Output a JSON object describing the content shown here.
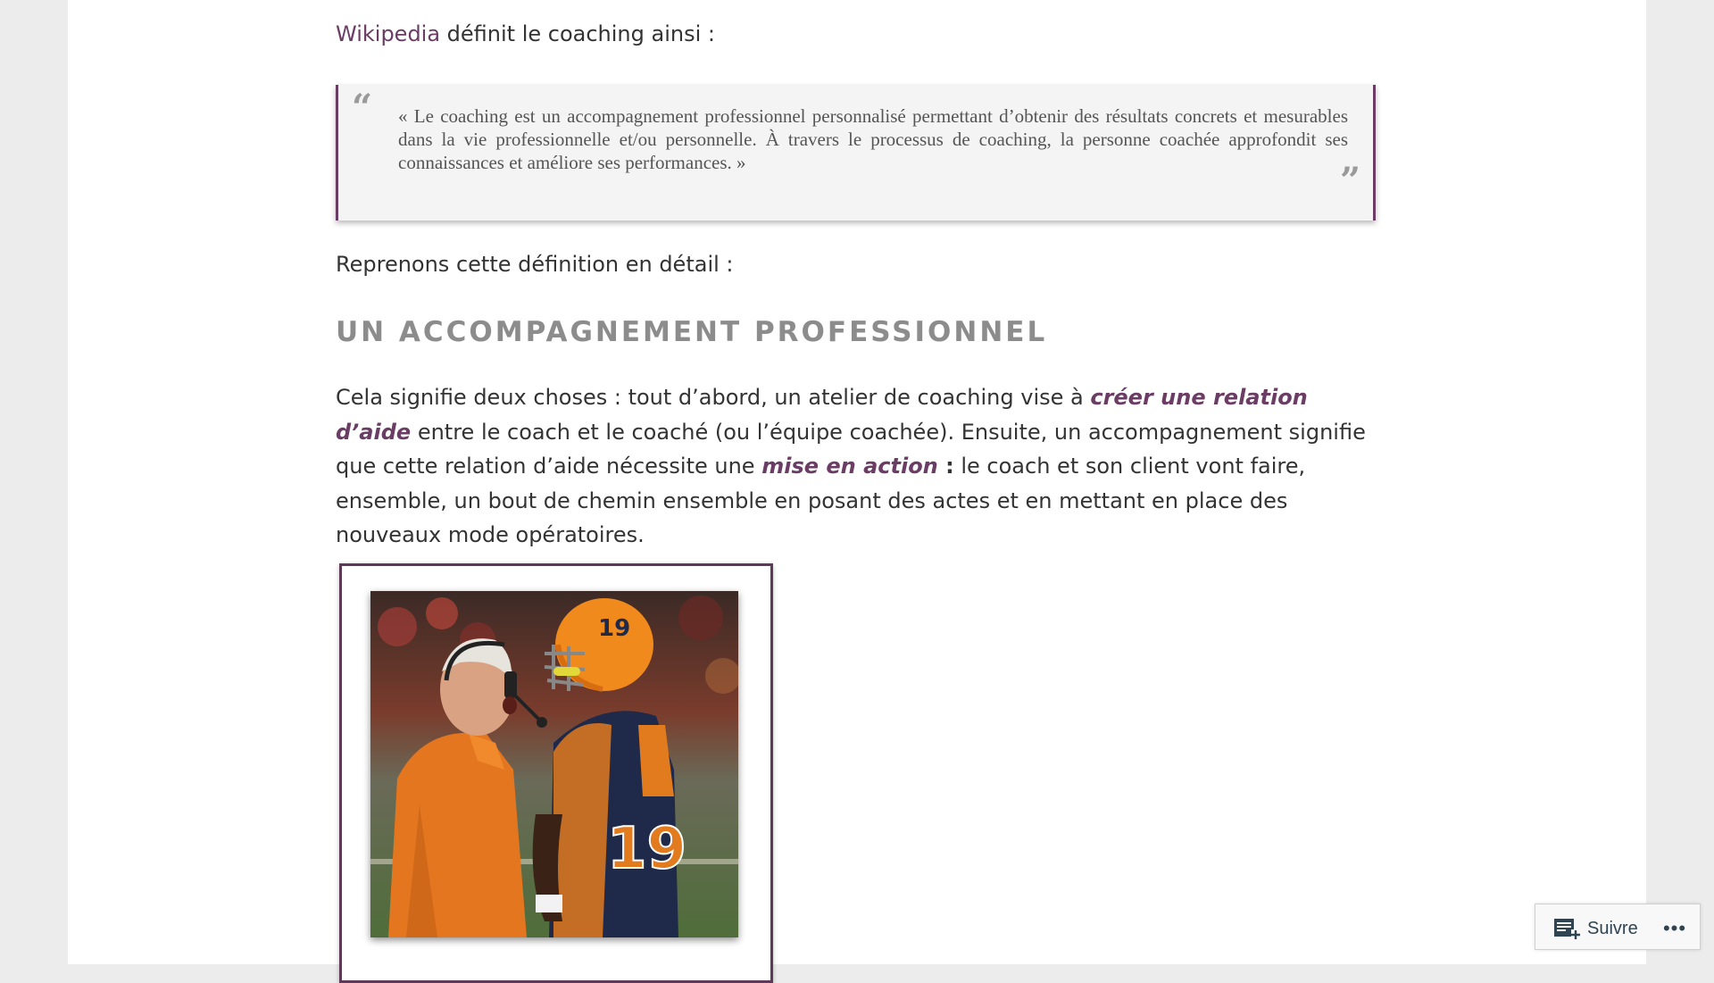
{
  "intro": {
    "link_text": "Wikipedia",
    "rest_text": " définit le coaching ainsi :"
  },
  "quote": {
    "open_mark": "“",
    "text": "« Le coaching est un accompagnement professionnel personnalisé permettant d’obtenir des résultats concrets et mesurables dans la vie professionnelle et/ou personnelle. À travers le processus de coaching, la personne coachée approfondit ses connaissances et améliore ses performances. »",
    "close_mark": "”"
  },
  "para2": "Reprenons cette définition en détail :",
  "heading": "UN ACCOMPAGNEMENT PROFESSIONNEL",
  "body": {
    "part1": "Cela signifie deux choses : tout d’abord, un atelier de coaching vise à ",
    "emph1": "créer une relation d’aide",
    "part2": " entre le coach et le coaché (ou l’équipe coachée). Ensuite, un accompagnement signifie que cette relation d’aide nécessite une ",
    "emph2": "mise en action",
    "colon": " :",
    "part3": " le coach et son client vont faire, ensemble, un bout de chemin ensemble en posant des actes et en mettant en place des nouveaux mode opératoires."
  },
  "image": {
    "jersey_number": "19"
  },
  "follow": {
    "label": "Suivre",
    "icon": "reader-follow-icon",
    "more": "•••"
  },
  "colors": {
    "accent": "#6b3c64",
    "heading": "#8c8c8c",
    "text": "#333333",
    "page_bg": "#ececec"
  }
}
